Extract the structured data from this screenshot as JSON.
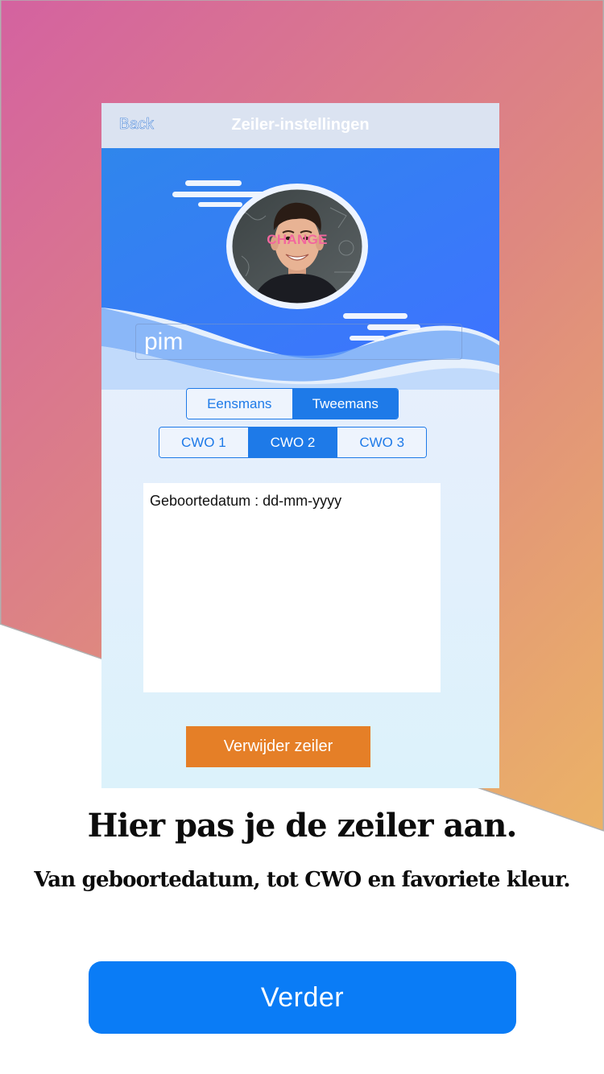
{
  "colors": {
    "gradient_start": "#d462a0",
    "gradient_end": "#efc05e",
    "accent_blue": "#1e7ae8",
    "primary_button": "#0a7cf6",
    "delete_button": "#e57f27",
    "change_label": "#f2679e"
  },
  "phone": {
    "nav": {
      "back_label": "Back",
      "title": "Zeiler-instellingen"
    },
    "avatar": {
      "change_label": "CHANGE",
      "icon": "profile-photo"
    },
    "name_input": {
      "value": "pim"
    },
    "boat_type": {
      "options": [
        "Eensmans",
        "Tweemans"
      ],
      "selected": "Tweemans"
    },
    "cwo_level": {
      "options": [
        "CWO 1",
        "CWO 2",
        "CWO 3"
      ],
      "selected": "CWO 2"
    },
    "birthdate_label": "Geboortedatum : dd-mm-yyyy",
    "delete_button_label": "Verwijder zeiler"
  },
  "headline": "Hier pas je de zeiler aan.",
  "subline": "Van geboortedatum, tot CWO en favoriete kleur.",
  "next_button_label": "Verder"
}
